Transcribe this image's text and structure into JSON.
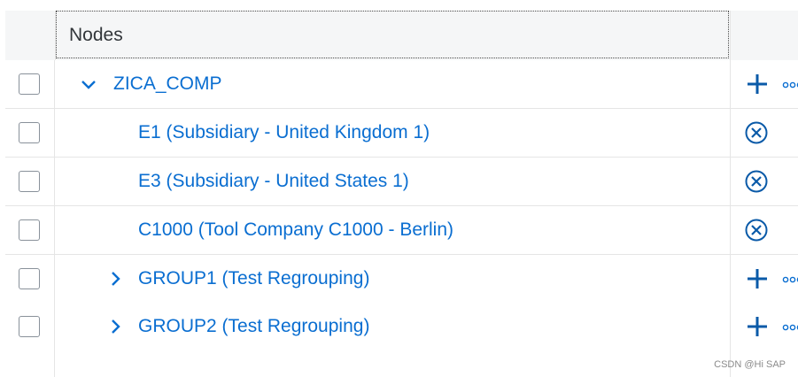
{
  "table": {
    "header": {
      "nodes_label": "Nodes"
    },
    "rows": [
      {
        "label": "ZICA_COMP",
        "expander": "chevron-down",
        "actions": [
          "add",
          "more"
        ]
      },
      {
        "label": "E1 (Subsidiary - United Kingdom 1)",
        "expander": "",
        "actions": [
          "remove"
        ]
      },
      {
        "label": "E3 (Subsidiary - United States 1)",
        "expander": "",
        "actions": [
          "remove"
        ]
      },
      {
        "label": "C1000 (Tool Company C1000 - Berlin)",
        "expander": "",
        "actions": [
          "remove"
        ]
      },
      {
        "label": "GROUP1 (Test Regrouping)",
        "expander": "chevron-right",
        "actions": [
          "add",
          "more"
        ]
      },
      {
        "label": "GROUP2 (Test Regrouping)",
        "expander": "chevron-right",
        "actions": [
          "add",
          "more"
        ]
      }
    ]
  },
  "watermark": "CSDN @Hi SAP",
  "colors": {
    "link": "#0a6ed1",
    "header_bg": "#f5f6f7",
    "border": "#e5e5e5"
  }
}
